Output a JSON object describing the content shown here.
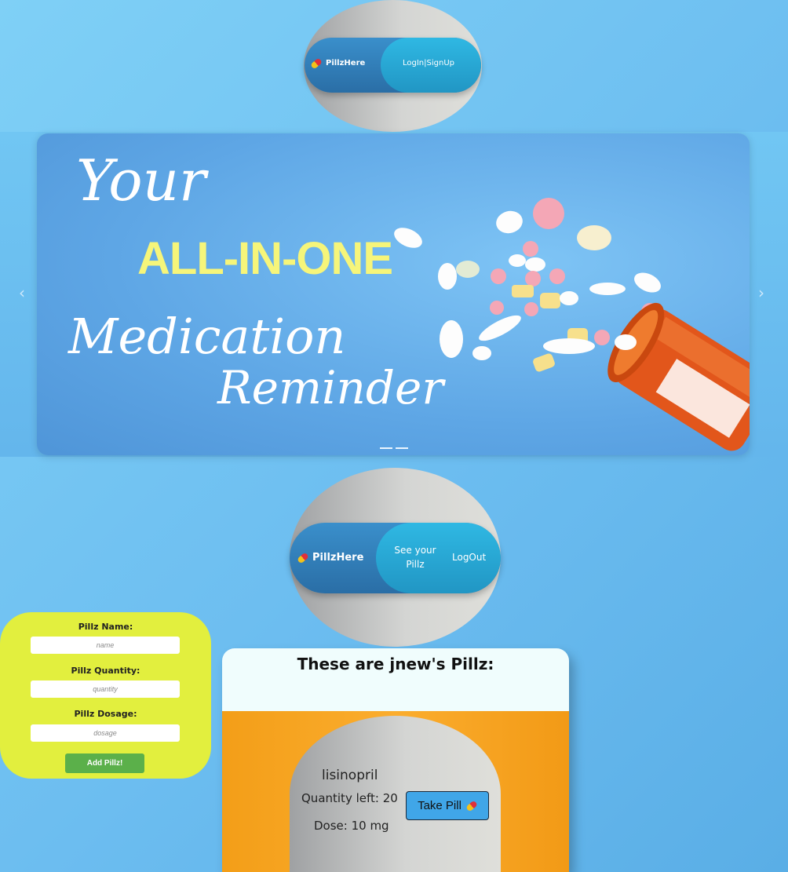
{
  "nav1": {
    "brand": "PillzHere",
    "login": "LogIn|SignUp"
  },
  "hero": {
    "line1": "Your",
    "line2": "ALL-IN-ONE",
    "line3": "Medication",
    "line4": "Reminder",
    "prev": "‹",
    "next": "›"
  },
  "nav2": {
    "brand": "PillzHere",
    "see_line1": "See your",
    "see_line2": "Pillz",
    "logout": "LogOut"
  },
  "form": {
    "name_label": "Pillz Name:",
    "name_placeholder": "name",
    "quantity_label": "Pillz Quantity:",
    "quantity_placeholder": "quantity",
    "dosage_label": "Pillz Dosage:",
    "dosage_placeholder": "dosage",
    "submit": "Add Pillz!"
  },
  "pills": {
    "title": "These are jnew's Pillz:",
    "items": [
      {
        "name": "lisinopril",
        "quantity": "Quantity left: 20",
        "dose": "Dose: 10 mg",
        "action": "Take Pill"
      }
    ]
  },
  "colors": {
    "accent": "#40a6e8",
    "form_bg": "#e2ef3e",
    "card_bg": "#f39e18",
    "add_button": "#5bb04a"
  }
}
